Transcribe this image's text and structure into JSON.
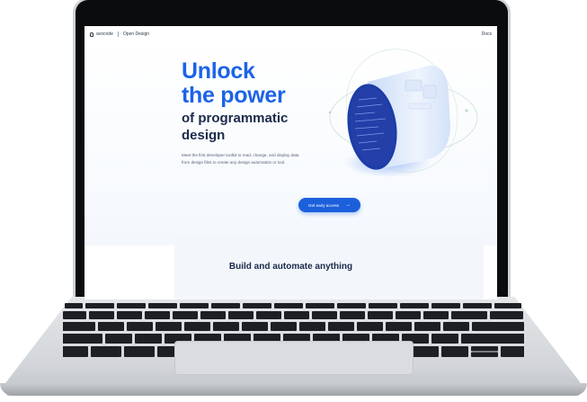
{
  "nav": {
    "brand": "avocode",
    "product": "Open Design",
    "link": "Docs"
  },
  "hero": {
    "title_line1": "Unlock",
    "title_line2": "the power",
    "subtitle_line1": "of programmatic",
    "subtitle_line2": "design",
    "description": "Meet the first developer toolkit to read, change, and display data from design files to create any design automation or tool.",
    "cta_label": "Get early access"
  },
  "section": {
    "title": "Build and automate anything",
    "subtitle": ""
  },
  "colors": {
    "accent": "#1c63e8",
    "heading": "#1a2a4a",
    "cta": "#1b5fdb",
    "bezel": "#0b0c0e"
  }
}
